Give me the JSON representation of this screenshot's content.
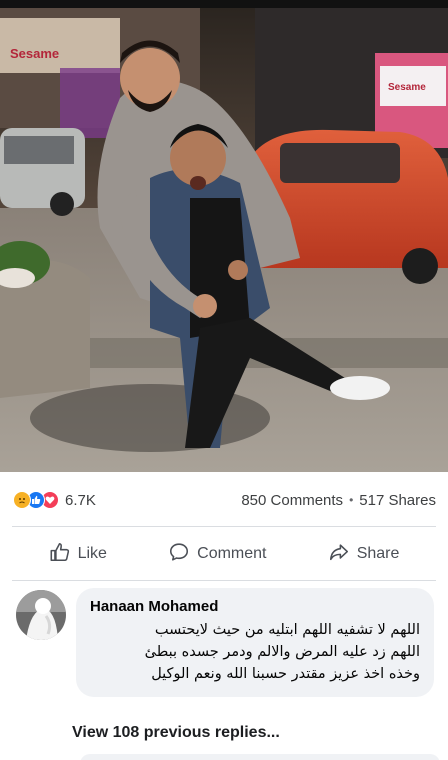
{
  "post": {
    "reactions": {
      "icons": [
        "sad-react",
        "like-react",
        "love-react"
      ],
      "count": "6.7K"
    },
    "comments_label": "850 Comments",
    "separator": "•",
    "shares_label": "517 Shares",
    "photo_signs": {
      "left": "Sesame",
      "right": "Sesame"
    }
  },
  "actions": {
    "like": "Like",
    "comment": "Comment",
    "share": "Share"
  },
  "comment": {
    "author": "Hanaan Mohamed",
    "lines": [
      "اللهم لا تشفيه اللهم ابتليه من حيث لايحتسب",
      "اللهم زد عليه المرض والالم ودمر جسده ببطئ",
      "وخذه اخذ عزيز مقتدر حسبنا الله ونعم الوكيل"
    ]
  },
  "view_replies": "View 108 previous replies...",
  "colors": {
    "accent": "#1877f2",
    "text_secondary": "#65676b",
    "bubble": "#f0f2f5"
  }
}
